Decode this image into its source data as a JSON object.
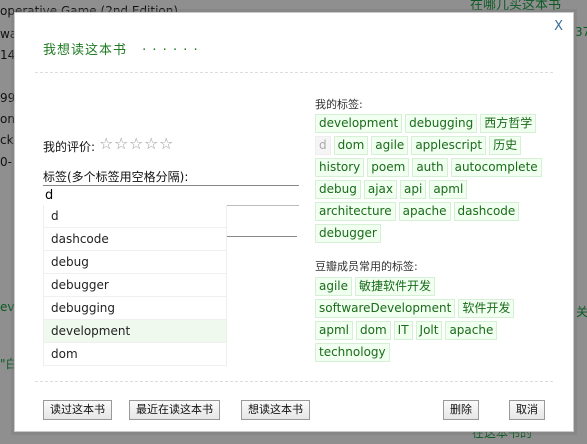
{
  "background": {
    "left_lines": [
      "operative Game (2nd Edition)",
      "wa",
      "14",
      "",
      "99",
      "on-",
      "ck",
      "0-"
    ],
    "top_right_link": "在哪儿买这本书",
    "right_fragments": [
      "37",
      "0",
      "3",
      "a",
      "一",
      "(",
      "Aw",
      "ul",
      "关",
      "ev",
      "\"白"
    ],
    "bottom_right": "在这本书的"
  },
  "dialog": {
    "close_label": "X",
    "title": "我想读这本书",
    "title_dots": "· · · · · ·",
    "rating_label": "我的评价:",
    "stars": [
      "☆",
      "☆",
      "☆",
      "☆",
      "☆"
    ],
    "tags_label": "标签(多个标签用空格分隔):",
    "tags_input_value": "d",
    "suggestions": [
      "d",
      "dashcode",
      "debug",
      "debugger",
      "debugging",
      "development",
      "dom"
    ],
    "active_suggestion_index": 5,
    "my_tags_label": "我的标签:",
    "my_tags": [
      "development",
      "debugging",
      "西方哲学",
      "d",
      "dom",
      "agile",
      "applescript",
      "历史",
      "history",
      "poem",
      "auth",
      "autocomplete",
      "debug",
      "ajax",
      "api",
      "apml",
      "architecture",
      "apache",
      "dashcode",
      "debugger"
    ],
    "selected_tag": "d",
    "popular_tags_label": "豆瓣成员常用的标签:",
    "popular_tags": [
      "agile",
      "敏捷软件开发",
      "softwareDevelopment",
      "软件开发",
      "apml",
      "dom",
      "IT",
      "Jolt",
      "apache",
      "technology"
    ],
    "buttons": {
      "read": "读过这本书",
      "reading": "最近在读这本书",
      "want": "想读这本书",
      "delete": "删除",
      "cancel": "取消"
    }
  }
}
